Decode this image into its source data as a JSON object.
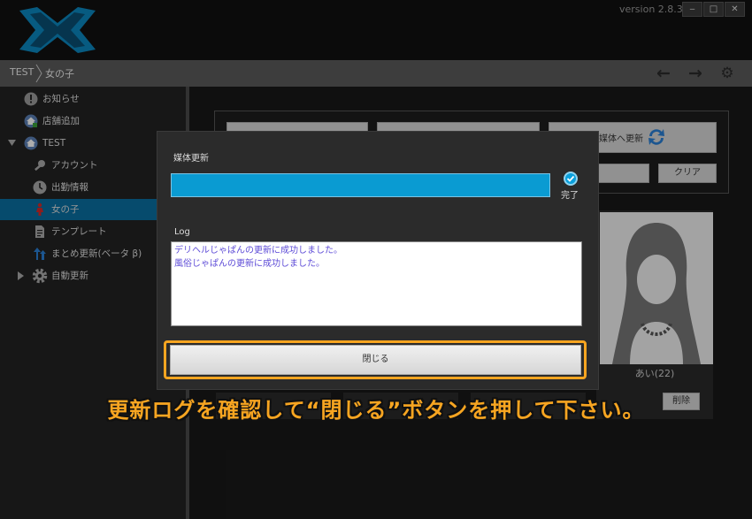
{
  "app": {
    "version": "version 2.8.3"
  },
  "window_controls": {
    "minimize": "‒",
    "maximize": "□",
    "close": "✕"
  },
  "breadcrumb": {
    "root": "TEST",
    "current": "女の子"
  },
  "nav": {
    "back": "←",
    "forward": "→",
    "settings": "⚙"
  },
  "sidebar": {
    "items": [
      {
        "label": "お知らせ",
        "icon": "info-icon"
      },
      {
        "label": "店舗追加",
        "icon": "home-add-icon"
      },
      {
        "label": "TEST",
        "icon": "home-icon",
        "expanded": true
      },
      {
        "label": "アカウント",
        "icon": "key-icon"
      },
      {
        "label": "出勤情報",
        "icon": "clock-icon"
      },
      {
        "label": "女の子",
        "icon": "girl-icon",
        "active": true
      },
      {
        "label": "テンプレート",
        "icon": "document-icon"
      },
      {
        "label": "まとめ更新(ベータ β)",
        "icon": "batch-update-icon"
      },
      {
        "label": "自動更新",
        "icon": "gear-icon",
        "collapsed": true
      }
    ]
  },
  "main": {
    "media_update_button": "媒体へ更新",
    "clear_button": "クリア",
    "profile": {
      "name": "あい(22)",
      "delete_button": "削除"
    }
  },
  "modal": {
    "title": "媒体更新",
    "progress": 1.0,
    "status": "完了",
    "log_title": "Log",
    "log_lines": [
      "デリヘルじゃぱんの更新に成功しました。",
      "風俗じゃぱんの更新に成功しました。"
    ],
    "close_button": "閉じる"
  },
  "instruction": "更新ログを確認して“閉じる”ボタンを押して下さい。",
  "colors": {
    "accent": "#0a9bd2",
    "highlight": "#f7a521",
    "log_text": "#5d4bd7"
  }
}
